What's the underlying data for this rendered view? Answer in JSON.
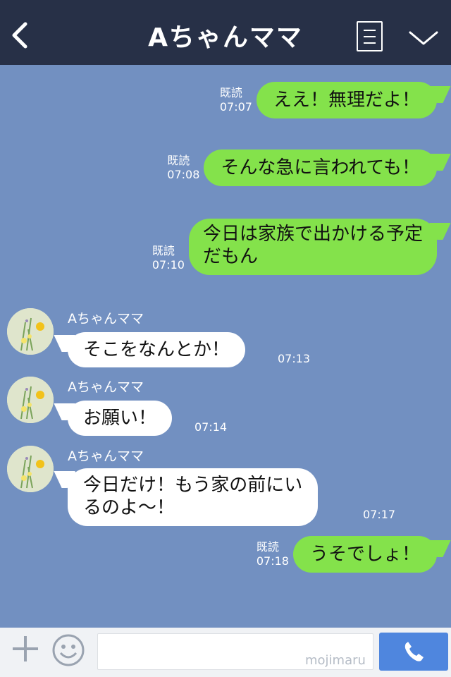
{
  "header": {
    "title": "Aちゃんママ",
    "back_icon": "chevron-left-icon",
    "menu_icon": "list-icon",
    "more_icon": "chevron-down-icon"
  },
  "messages": [
    {
      "dir": "sent",
      "read": "既読",
      "time": "07:07",
      "lines": [
        "ええ！無理だよ！"
      ]
    },
    {
      "dir": "sent",
      "read": "既読",
      "time": "07:08",
      "lines": [
        "そんな急に言われても！"
      ]
    },
    {
      "dir": "sent",
      "read": "既読",
      "time": "07:10",
      "lines": [
        "今日は家族で出かける予定",
        "だもん"
      ]
    },
    {
      "dir": "recv",
      "name": "Aちゃんママ",
      "time": "07:13",
      "lines": [
        "そこをなんとか！"
      ]
    },
    {
      "dir": "recv",
      "name": "Aちゃんママ",
      "time": "07:14",
      "lines": [
        "お願い！"
      ]
    },
    {
      "dir": "recv",
      "name": "Aちゃんママ",
      "time": "07:17",
      "lines": [
        "今日だけ！もう家の前にい",
        "るのよ〜！"
      ]
    },
    {
      "dir": "sent",
      "read": "既読",
      "time": "07:18",
      "lines": [
        "うそでしょ！"
      ]
    }
  ],
  "footer": {
    "input_value": "",
    "watermark": "mojimaru",
    "plus_icon": "plus-icon",
    "emoji_icon": "smiley-icon",
    "call_icon": "phone-icon"
  },
  "colors": {
    "header_bg": "#273047",
    "chat_bg": "#7290c1",
    "sent_bubble": "#84e24b",
    "recv_bubble": "#ffffff",
    "call_button": "#4f86de"
  }
}
